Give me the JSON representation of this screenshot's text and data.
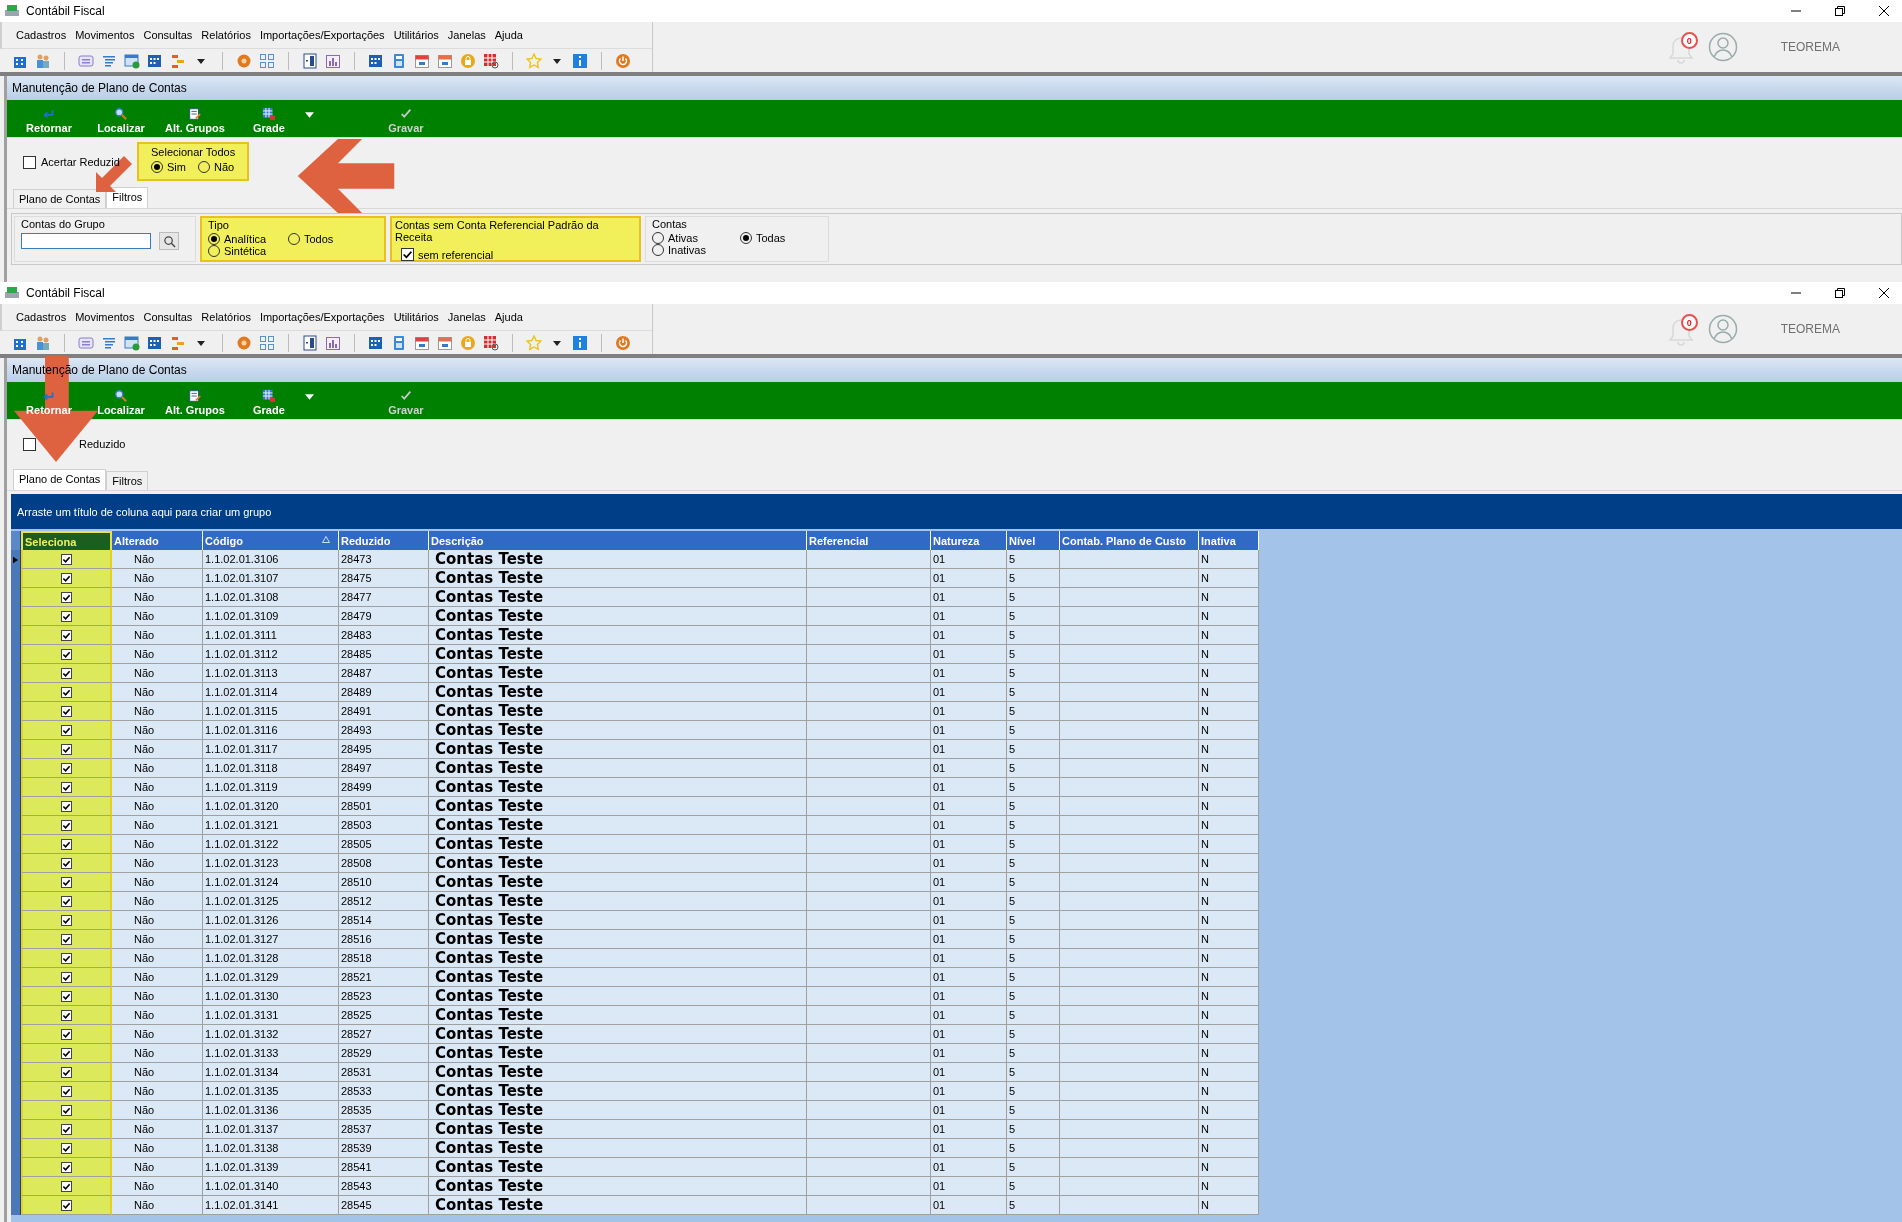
{
  "windows": [
    {
      "title": "Contábil Fiscal",
      "menu": [
        "Cadastros",
        "Movimentos",
        "Consultas",
        "Relatórios",
        "Importações/Exportações",
        "Utilitários",
        "Janelas",
        "Ajuda"
      ],
      "notifications": "0",
      "user": "TEOREMA",
      "form_title": "Manutenção de Plano de Contas",
      "toolbar": [
        {
          "label": "Retornar",
          "disabled": false
        },
        {
          "label": "Localizar",
          "disabled": false
        },
        {
          "label": "Alt. Grupos",
          "disabled": false
        },
        {
          "label": "Grade",
          "disabled": false
        },
        {
          "label": "Gravar",
          "disabled": true
        }
      ],
      "acertar": {
        "label": "Acertar Reduzid",
        "checked": false
      },
      "selecionar_todos": {
        "title": "Selecionar Todos",
        "highlighted": true,
        "options": [
          {
            "label": "Sim",
            "selected": true
          },
          {
            "label": "Não",
            "selected": false
          }
        ]
      },
      "tabs": [
        {
          "label": "Plano de Contas",
          "selected": false
        },
        {
          "label": "Filtros",
          "selected": true
        }
      ],
      "filters": {
        "grupo": {
          "title": "Contas do Grupo"
        },
        "tipo": {
          "title": "Tipo",
          "highlighted": true,
          "options": [
            {
              "label": "Analítica",
              "selected": true
            },
            {
              "label": "Todos",
              "selected": false
            },
            {
              "label": "Sintética",
              "selected": false
            }
          ]
        },
        "referencial": {
          "title": "Contas sem Conta Referencial Padrão da Receita",
          "highlighted": true,
          "checkbox": {
            "label": "sem referencial",
            "checked": true
          }
        },
        "contas": {
          "title": "Contas",
          "highlighted": false,
          "options": [
            {
              "label": "Ativas",
              "selected": false
            },
            {
              "label": "Todas",
              "selected": true
            },
            {
              "label": "Inativas",
              "selected": false
            }
          ]
        }
      }
    },
    {
      "title": "Contábil Fiscal",
      "menu": [
        "Cadastros",
        "Movimentos",
        "Consultas",
        "Relatórios",
        "Importações/Exportações",
        "Utilitários",
        "Janelas",
        "Ajuda"
      ],
      "notifications": "0",
      "user": "TEOREMA",
      "form_title": "Manutenção de Plano de Contas",
      "toolbar": [
        {
          "label": "Retornar",
          "disabled": false
        },
        {
          "label": "Localizar",
          "disabled": false
        },
        {
          "label": "Alt. Grupos",
          "disabled": false
        },
        {
          "label": "Grade",
          "disabled": false
        },
        {
          "label": "Gravar",
          "disabled": true
        }
      ],
      "acertar": {
        "label": "Reduzido",
        "checked": false
      },
      "tabs": [
        {
          "label": "Plano de Contas",
          "selected": true
        },
        {
          "label": "Filtros",
          "selected": false
        }
      ],
      "grid": {
        "group_hint": "Arraste um título de coluna aqui para criar um grupo",
        "columns": [
          {
            "label": "Seleciona",
            "highlighted": true,
            "sorted": false
          },
          {
            "label": "Alterado",
            "highlighted": false,
            "sorted": false
          },
          {
            "label": "Código",
            "highlighted": false,
            "sorted": true
          },
          {
            "label": "Reduzido",
            "highlighted": false,
            "sorted": false
          },
          {
            "label": "Descrição",
            "highlighted": false,
            "sorted": false
          },
          {
            "label": "Referencial",
            "highlighted": false,
            "sorted": false
          },
          {
            "label": "Natureza",
            "highlighted": false,
            "sorted": false
          },
          {
            "label": "Nível",
            "highlighted": false,
            "sorted": false
          },
          {
            "label": "Contab. Plano de Custo",
            "highlighted": false,
            "sorted": false
          },
          {
            "label": "Inativa",
            "highlighted": false,
            "sorted": false
          }
        ],
        "rows": [
          {
            "current": true,
            "checked": true,
            "alterado": "Não",
            "codigo": "1.1.02.01.3106",
            "reduzido": "28473",
            "descricao": "Contas Teste",
            "natureza": "01",
            "nivel": "5",
            "inativa": "N"
          },
          {
            "current": false,
            "checked": true,
            "alterado": "Não",
            "codigo": "1.1.02.01.3107",
            "reduzido": "28475",
            "descricao": "Contas Teste",
            "natureza": "01",
            "nivel": "5",
            "inativa": "N"
          },
          {
            "current": false,
            "checked": true,
            "alterado": "Não",
            "codigo": "1.1.02.01.3108",
            "reduzido": "28477",
            "descricao": "Contas Teste",
            "natureza": "01",
            "nivel": "5",
            "inativa": "N"
          },
          {
            "current": false,
            "checked": true,
            "alterado": "Não",
            "codigo": "1.1.02.01.3109",
            "reduzido": "28479",
            "descricao": "Contas Teste",
            "natureza": "01",
            "nivel": "5",
            "inativa": "N"
          },
          {
            "current": false,
            "checked": true,
            "alterado": "Não",
            "codigo": "1.1.02.01.3111",
            "reduzido": "28483",
            "descricao": "Contas Teste",
            "natureza": "01",
            "nivel": "5",
            "inativa": "N"
          },
          {
            "current": false,
            "checked": true,
            "alterado": "Não",
            "codigo": "1.1.02.01.3112",
            "reduzido": "28485",
            "descricao": "Contas Teste",
            "natureza": "01",
            "nivel": "5",
            "inativa": "N"
          },
          {
            "current": false,
            "checked": true,
            "alterado": "Não",
            "codigo": "1.1.02.01.3113",
            "reduzido": "28487",
            "descricao": "Contas Teste",
            "natureza": "01",
            "nivel": "5",
            "inativa": "N"
          },
          {
            "current": false,
            "checked": true,
            "alterado": "Não",
            "codigo": "1.1.02.01.3114",
            "reduzido": "28489",
            "descricao": "Contas Teste",
            "natureza": "01",
            "nivel": "5",
            "inativa": "N"
          },
          {
            "current": false,
            "checked": true,
            "alterado": "Não",
            "codigo": "1.1.02.01.3115",
            "reduzido": "28491",
            "descricao": "Contas Teste",
            "natureza": "01",
            "nivel": "5",
            "inativa": "N"
          },
          {
            "current": false,
            "checked": true,
            "alterado": "Não",
            "codigo": "1.1.02.01.3116",
            "reduzido": "28493",
            "descricao": "Contas Teste",
            "natureza": "01",
            "nivel": "5",
            "inativa": "N"
          },
          {
            "current": false,
            "checked": true,
            "alterado": "Não",
            "codigo": "1.1.02.01.3117",
            "reduzido": "28495",
            "descricao": "Contas Teste",
            "natureza": "01",
            "nivel": "5",
            "inativa": "N"
          },
          {
            "current": false,
            "checked": true,
            "alterado": "Não",
            "codigo": "1.1.02.01.3118",
            "reduzido": "28497",
            "descricao": "Contas Teste",
            "natureza": "01",
            "nivel": "5",
            "inativa": "N"
          },
          {
            "current": false,
            "checked": true,
            "alterado": "Não",
            "codigo": "1.1.02.01.3119",
            "reduzido": "28499",
            "descricao": "Contas Teste",
            "natureza": "01",
            "nivel": "5",
            "inativa": "N"
          },
          {
            "current": false,
            "checked": true,
            "alterado": "Não",
            "codigo": "1.1.02.01.3120",
            "reduzido": "28501",
            "descricao": "Contas Teste",
            "natureza": "01",
            "nivel": "5",
            "inativa": "N"
          },
          {
            "current": false,
            "checked": true,
            "alterado": "Não",
            "codigo": "1.1.02.01.3121",
            "reduzido": "28503",
            "descricao": "Contas Teste",
            "natureza": "01",
            "nivel": "5",
            "inativa": "N"
          },
          {
            "current": false,
            "checked": true,
            "alterado": "Não",
            "codigo": "1.1.02.01.3122",
            "reduzido": "28505",
            "descricao": "Contas Teste",
            "natureza": "01",
            "nivel": "5",
            "inativa": "N"
          },
          {
            "current": false,
            "checked": true,
            "alterado": "Não",
            "codigo": "1.1.02.01.3123",
            "reduzido": "28508",
            "descricao": "Contas Teste",
            "natureza": "01",
            "nivel": "5",
            "inativa": "N"
          },
          {
            "current": false,
            "checked": true,
            "alterado": "Não",
            "codigo": "1.1.02.01.3124",
            "reduzido": "28510",
            "descricao": "Contas Teste",
            "natureza": "01",
            "nivel": "5",
            "inativa": "N"
          },
          {
            "current": false,
            "checked": true,
            "alterado": "Não",
            "codigo": "1.1.02.01.3125",
            "reduzido": "28512",
            "descricao": "Contas Teste",
            "natureza": "01",
            "nivel": "5",
            "inativa": "N"
          },
          {
            "current": false,
            "checked": true,
            "alterado": "Não",
            "codigo": "1.1.02.01.3126",
            "reduzido": "28514",
            "descricao": "Contas Teste",
            "natureza": "01",
            "nivel": "5",
            "inativa": "N"
          },
          {
            "current": false,
            "checked": true,
            "alterado": "Não",
            "codigo": "1.1.02.01.3127",
            "reduzido": "28516",
            "descricao": "Contas Teste",
            "natureza": "01",
            "nivel": "5",
            "inativa": "N"
          },
          {
            "current": false,
            "checked": true,
            "alterado": "Não",
            "codigo": "1.1.02.01.3128",
            "reduzido": "28518",
            "descricao": "Contas Teste",
            "natureza": "01",
            "nivel": "5",
            "inativa": "N"
          },
          {
            "current": false,
            "checked": true,
            "alterado": "Não",
            "codigo": "1.1.02.01.3129",
            "reduzido": "28521",
            "descricao": "Contas Teste",
            "natureza": "01",
            "nivel": "5",
            "inativa": "N"
          },
          {
            "current": false,
            "checked": true,
            "alterado": "Não",
            "codigo": "1.1.02.01.3130",
            "reduzido": "28523",
            "descricao": "Contas Teste",
            "natureza": "01",
            "nivel": "5",
            "inativa": "N"
          },
          {
            "current": false,
            "checked": true,
            "alterado": "Não",
            "codigo": "1.1.02.01.3131",
            "reduzido": "28525",
            "descricao": "Contas Teste",
            "natureza": "01",
            "nivel": "5",
            "inativa": "N"
          },
          {
            "current": false,
            "checked": true,
            "alterado": "Não",
            "codigo": "1.1.02.01.3132",
            "reduzido": "28527",
            "descricao": "Contas Teste",
            "natureza": "01",
            "nivel": "5",
            "inativa": "N"
          },
          {
            "current": false,
            "checked": true,
            "alterado": "Não",
            "codigo": "1.1.02.01.3133",
            "reduzido": "28529",
            "descricao": "Contas Teste",
            "natureza": "01",
            "nivel": "5",
            "inativa": "N"
          },
          {
            "current": false,
            "checked": true,
            "alterado": "Não",
            "codigo": "1.1.02.01.3134",
            "reduzido": "28531",
            "descricao": "Contas Teste",
            "natureza": "01",
            "nivel": "5",
            "inativa": "N"
          },
          {
            "current": false,
            "checked": true,
            "alterado": "Não",
            "codigo": "1.1.02.01.3135",
            "reduzido": "28533",
            "descricao": "Contas Teste",
            "natureza": "01",
            "nivel": "5",
            "inativa": "N"
          },
          {
            "current": false,
            "checked": true,
            "alterado": "Não",
            "codigo": "1.1.02.01.3136",
            "reduzido": "28535",
            "descricao": "Contas Teste",
            "natureza": "01",
            "nivel": "5",
            "inativa": "N"
          },
          {
            "current": false,
            "checked": true,
            "alterado": "Não",
            "codigo": "1.1.02.01.3137",
            "reduzido": "28537",
            "descricao": "Contas Teste",
            "natureza": "01",
            "nivel": "5",
            "inativa": "N"
          },
          {
            "current": false,
            "checked": true,
            "alterado": "Não",
            "codigo": "1.1.02.01.3138",
            "reduzido": "28539",
            "descricao": "Contas Teste",
            "natureza": "01",
            "nivel": "5",
            "inativa": "N"
          },
          {
            "current": false,
            "checked": true,
            "alterado": "Não",
            "codigo": "1.1.02.01.3139",
            "reduzido": "28541",
            "descricao": "Contas Teste",
            "natureza": "01",
            "nivel": "5",
            "inativa": "N"
          },
          {
            "current": false,
            "checked": true,
            "alterado": "Não",
            "codigo": "1.1.02.01.3140",
            "reduzido": "28543",
            "descricao": "Contas Teste",
            "natureza": "01",
            "nivel": "5",
            "inativa": "N"
          },
          {
            "current": false,
            "checked": true,
            "alterado": "Não",
            "codigo": "1.1.02.01.3141",
            "reduzido": "28545",
            "descricao": "Contas Teste",
            "natureza": "01",
            "nivel": "5",
            "inativa": "N"
          }
        ]
      }
    }
  ]
}
